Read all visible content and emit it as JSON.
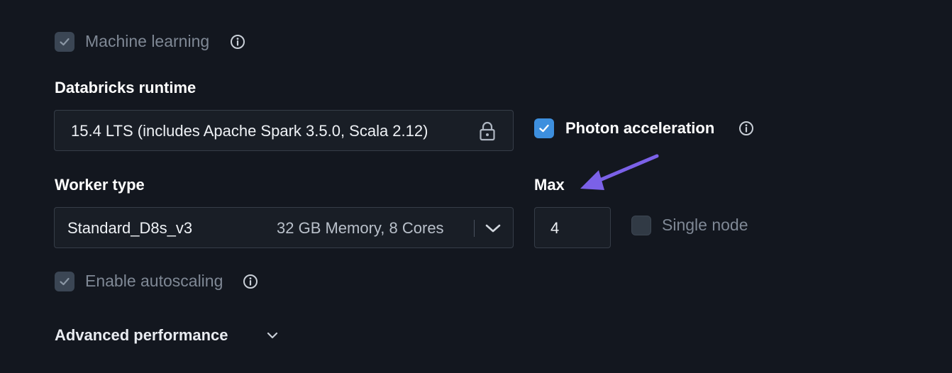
{
  "machine_learning": {
    "label": "Machine learning",
    "checked": true,
    "disabled": true,
    "info_icon": "info-icon"
  },
  "runtime": {
    "heading": "Databricks runtime",
    "value": "15.4 LTS (includes Apache Spark 3.5.0, Scala 2.12)",
    "lock_icon": "lock-icon"
  },
  "photon": {
    "label": "Photon acceleration",
    "checked": true,
    "info_icon": "info-icon"
  },
  "worker_type": {
    "heading": "Worker type",
    "value": "Standard_D8s_v3",
    "detail": "32 GB Memory, 8 Cores",
    "dropdown_icon": "chevron-down-icon"
  },
  "max_workers": {
    "heading": "Max",
    "value": "4"
  },
  "single_node": {
    "label": "Single node",
    "checked": false
  },
  "autoscaling": {
    "label": "Enable autoscaling",
    "checked": true,
    "disabled": true,
    "info_icon": "info-icon"
  },
  "advanced": {
    "label": "Advanced performance",
    "icon": "chevron-down-icon"
  },
  "annotation": {
    "icon": "arrow-icon",
    "color": "#7b61e8"
  },
  "colors": {
    "background": "#13171f",
    "checkbox_active": "#3d8fde",
    "checkbox_disabled": "#3b4654",
    "muted_text": "#7f8895"
  }
}
